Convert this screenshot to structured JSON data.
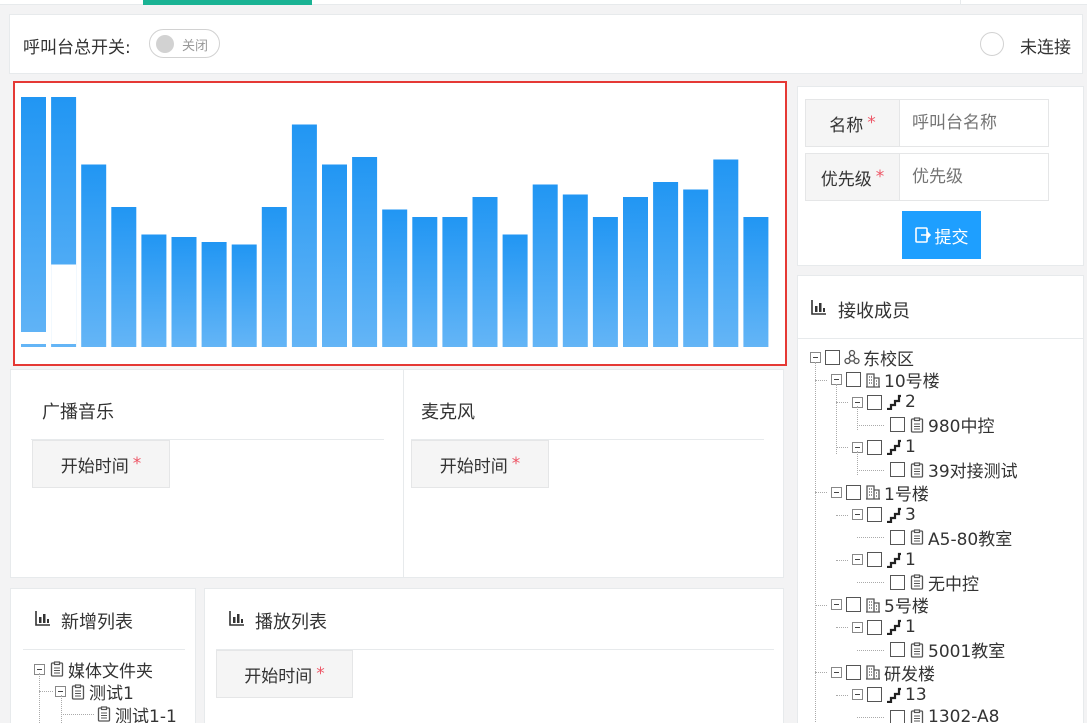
{
  "colors": {
    "accent": "#1ab394",
    "primary": "#1e9fff",
    "bar_top": "#2196f3",
    "bar_bottom": "#64b5f6",
    "chart_border": "#e53935",
    "required": "#ed5565"
  },
  "header": {
    "switch_label": "呼叫台总开关:",
    "switch_state": "关闭",
    "status": "未连接"
  },
  "chart_data": {
    "type": "bar",
    "series": [
      {
        "values": [
          100,
          100,
          73,
          56,
          45,
          44,
          42,
          41,
          56,
          89,
          73,
          76,
          55,
          52,
          52,
          60,
          45,
          65,
          61,
          52,
          60,
          66,
          63,
          75,
          52
        ]
      },
      {
        "values": [
          6,
          33,
          0,
          0,
          0,
          0,
          0,
          0,
          0,
          0,
          0,
          0,
          0,
          0,
          0,
          0,
          0,
          0,
          0,
          0,
          0,
          0,
          0,
          0,
          0
        ]
      }
    ],
    "ylim": [
      0,
      100
    ]
  },
  "broadcast": {
    "title": "广播音乐",
    "start_time": "开始时间"
  },
  "microphone": {
    "title": "麦克风",
    "start_time": "开始时间"
  },
  "new_list": {
    "title": "新增列表",
    "tree": [
      {
        "label": "媒体文件夹"
      },
      {
        "label": "测试1"
      },
      {
        "label": "测试1-1"
      }
    ]
  },
  "play_list": {
    "title": "播放列表",
    "start_time": "开始时间"
  },
  "form": {
    "name_label": "名称",
    "name_placeholder": "呼叫台名称",
    "priority_label": "优先级",
    "priority_placeholder": "优先级",
    "submit_label": "提交"
  },
  "members": {
    "title": "接收成员",
    "tree": [
      {
        "label": "东校区",
        "icon": "network-icon"
      },
      {
        "label": "10号楼",
        "icon": "building-icon"
      },
      {
        "label": "2",
        "icon": "stairs-icon"
      },
      {
        "label": "980中控",
        "icon": "clipboard-icon"
      },
      {
        "label": "1",
        "icon": "stairs-icon"
      },
      {
        "label": "39对接测试",
        "icon": "clipboard-icon"
      },
      {
        "label": "1号楼",
        "icon": "building-icon"
      },
      {
        "label": "3",
        "icon": "stairs-icon"
      },
      {
        "label": "A5-80教室",
        "icon": "clipboard-icon"
      },
      {
        "label": "1",
        "icon": "stairs-icon"
      },
      {
        "label": "无中控",
        "icon": "clipboard-icon"
      },
      {
        "label": "5号楼",
        "icon": "building-icon"
      },
      {
        "label": "1",
        "icon": "stairs-icon"
      },
      {
        "label": "5001教室",
        "icon": "clipboard-icon"
      },
      {
        "label": "研发楼",
        "icon": "building-icon"
      },
      {
        "label": "13",
        "icon": "stairs-icon"
      },
      {
        "label": "1302-A8",
        "icon": "clipboard-icon"
      }
    ]
  }
}
